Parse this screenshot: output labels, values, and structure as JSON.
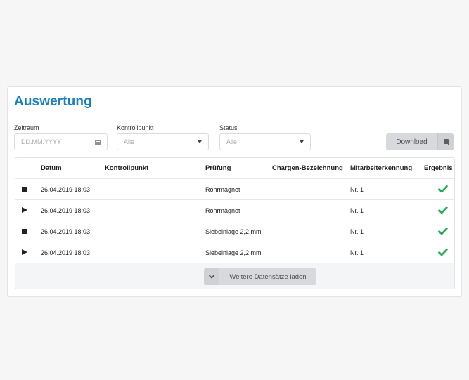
{
  "page": {
    "title": "Auswertung"
  },
  "filters": {
    "zeitraum": {
      "label": "Zeitraum",
      "placeholder": "DD.MM.YYYY"
    },
    "kontrollpunkt": {
      "label": "Kontrollpunkt",
      "value": "Alle"
    },
    "status": {
      "label": "Status",
      "value": "Alle"
    }
  },
  "toolbar": {
    "download_label": "Download"
  },
  "table": {
    "headers": {
      "datum": "Datum",
      "kontrollpunkt": "Kontrollpunkt",
      "pruefung": "Prüfung",
      "charge": "Chargen-Bezeichnung",
      "mitarbeiter": "Mitarbeiterkennung",
      "ergebnis": "Ergebnis"
    },
    "rows": [
      {
        "state_icon": "stop-icon",
        "datum": "26.04.2019 18:03",
        "kontrollpunkt": "",
        "pruefung": "Rohrmagnet",
        "charge": "",
        "mitarbeiter": "Nr. 1",
        "ergebnis": "check-icon"
      },
      {
        "state_icon": "play-icon",
        "datum": "26.04.2019 18:03",
        "kontrollpunkt": "",
        "pruefung": "Rohrmagnet",
        "charge": "",
        "mitarbeiter": "Nr. 1",
        "ergebnis": "check-icon"
      },
      {
        "state_icon": "stop-icon",
        "datum": "26.04.2019 18:03",
        "kontrollpunkt": "",
        "pruefung": "Siebeinlage 2,2 mm",
        "charge": "",
        "mitarbeiter": "Nr. 1",
        "ergebnis": "check-icon"
      },
      {
        "state_icon": "play-icon",
        "datum": "26.04.2019 18:03",
        "kontrollpunkt": "",
        "pruefung": "Siebeinlage 2,2 mm",
        "charge": "",
        "mitarbeiter": "Nr. 1",
        "ergebnis": "check-icon"
      }
    ],
    "load_more_label": "Weitere Datensätze laden"
  },
  "colors": {
    "accent": "#1a7fc1",
    "success": "#1fae55"
  }
}
